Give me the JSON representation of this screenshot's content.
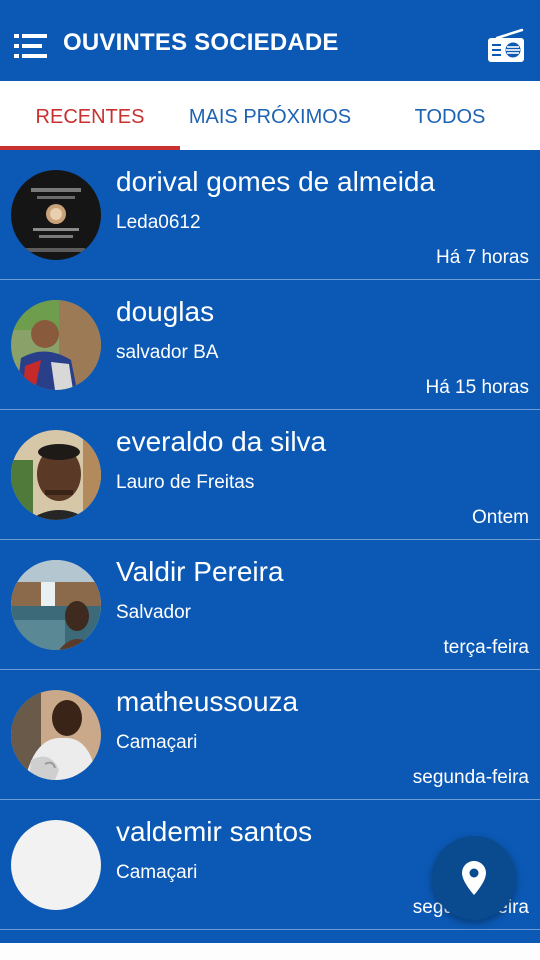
{
  "header": {
    "title": "OUVINTES SOCIEDADE",
    "menu_icon": "menu-icon",
    "radio_icon": "radio-icon"
  },
  "tabs": [
    {
      "label": "RECENTES",
      "active": true
    },
    {
      "label": "MAIS PRÓXIMOS",
      "active": false
    },
    {
      "label": "TODOS",
      "active": false
    }
  ],
  "colors": {
    "primary": "#0b59b5",
    "active_tab": "#c8312f",
    "tab_text": "#1d62b3",
    "fab": "#0a4a8f"
  },
  "listeners": [
    {
      "name": "dorival gomes de almeida",
      "city": "Leda0612",
      "time": "Há 7 horas"
    },
    {
      "name": "douglas",
      "city": "salvador BA",
      "time": "Há 15 horas"
    },
    {
      "name": "everaldo da silva",
      "city": "Lauro de Freitas",
      "time": "Ontem"
    },
    {
      "name": "Valdir Pereira",
      "city": "Salvador",
      "time": "terça-feira"
    },
    {
      "name": "matheussouza",
      "city": "Camaçari",
      "time": "segunda-feira"
    },
    {
      "name": "valdemir santos",
      "city": "Camaçari",
      "time": "segunda-feira"
    }
  ],
  "fab": {
    "icon": "location-pin-icon"
  }
}
